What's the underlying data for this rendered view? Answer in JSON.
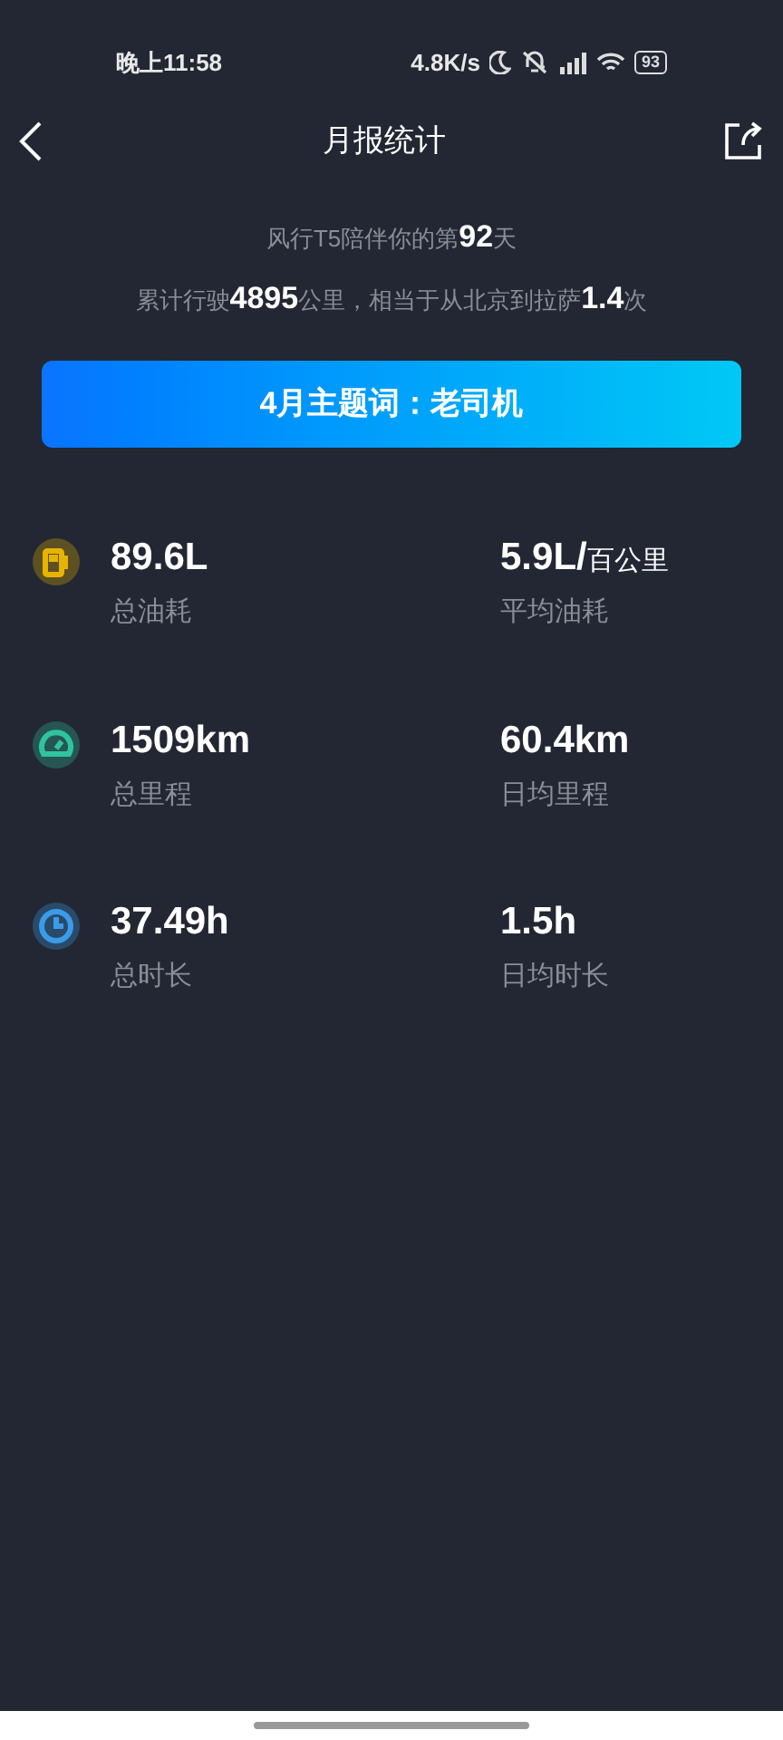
{
  "status_bar": {
    "time": "晚上11:58",
    "speed": "4.8K/s",
    "battery": "93"
  },
  "header": {
    "title": "月报统计"
  },
  "summary": [
    "风行T5陪伴你的第**92**天",
    "累计行驶**4895**公里，相当于从北京到拉萨**1.4**次"
  ],
  "theme_banner": "4月主题词：老司机",
  "stats": [
    {
      "kind": "fuel",
      "color": "#e6b400",
      "total": {
        "value": "89.6L",
        "label": "总油耗"
      },
      "average": {
        "value": "5.9L/",
        "unit": "百公里",
        "label": "平均油耗"
      }
    },
    {
      "kind": "gauge",
      "color": "#2ec4a0",
      "total": {
        "value": "1509km",
        "label": "总里程"
      },
      "average": {
        "value": "60.4km",
        "label": "日均里程"
      }
    },
    {
      "kind": "clock",
      "color": "#3a9ce8",
      "total": {
        "value": "37.49h",
        "label": "总时长"
      },
      "average": {
        "value": "1.5h",
        "label": "日均时长"
      }
    }
  ]
}
